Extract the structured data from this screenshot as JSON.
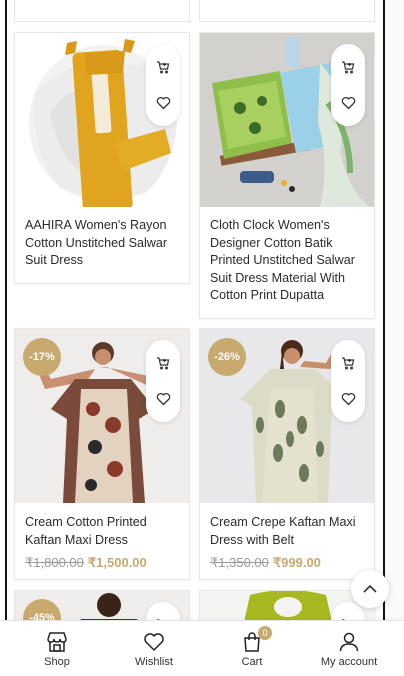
{
  "products": [
    {
      "title": "AAHIRA Women's Rayon Cotton Unstitched Salwar Suit Dress",
      "image": "yellow-salwar-suit-fabric",
      "badge": "",
      "old_price": "",
      "new_price": ""
    },
    {
      "title": "Cloth Clock Women's Designer Cotton Batik Printed Unstitched Salwar Suit Dress Material With Cotton Print Dupatta",
      "image": "green-batik-print-fabric",
      "badge": "",
      "old_price": "",
      "new_price": ""
    },
    {
      "title": "Cream Cotton Printed Kaftan Maxi Dress",
      "image": "woman-in-printed-kaftan",
      "badge": "-17%",
      "old_price": "₹1,800.00",
      "new_price": "₹1,500.00"
    },
    {
      "title": "Cream Crepe Kaftan Maxi Dress with Belt",
      "image": "woman-in-cream-crepe-kaftan",
      "badge": "-26%",
      "old_price": "₹1,350.00",
      "new_price": "₹999.00"
    },
    {
      "title": "",
      "image": "woman-in-floral-dress",
      "badge": "-45%",
      "old_price": "",
      "new_price": ""
    },
    {
      "title": "",
      "image": "lime-green-garment",
      "badge": "",
      "old_price": "",
      "new_price": ""
    }
  ],
  "bottom_nav": {
    "shop": "Shop",
    "wishlist": "Wishlist",
    "cart": "Cart",
    "cart_count": "0",
    "account": "My account"
  },
  "icons": {
    "add_to_cart": "cart-plus-icon",
    "wishlist": "heart-icon",
    "scroll_top": "chevron-up-icon",
    "shop": "store-icon",
    "cart": "shopping-bag-icon",
    "account": "user-icon"
  },
  "colors": {
    "accent": "#c8a96e",
    "text": "#2b2b2b",
    "old_price": "#9a9a9a"
  }
}
